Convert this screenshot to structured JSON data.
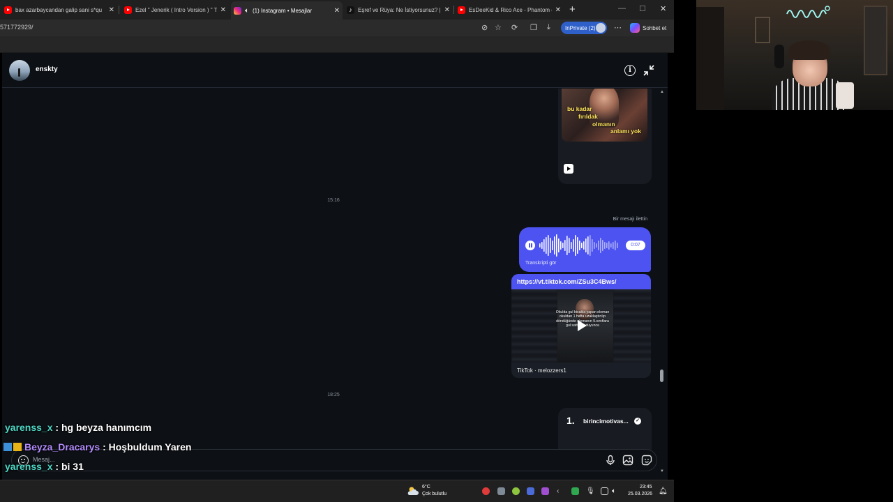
{
  "browser": {
    "tabs": [
      {
        "label": "bax azarbaycandan galip sani s*qu"
      },
      {
        "label": "Ezel \" Jenerik ( Intro Version ) \" To"
      },
      {
        "label": "(1) Instagram • Mesajlar"
      },
      {
        "label": "Eşref ve Rüya: Ne İstiyorsunuz? | Ta"
      },
      {
        "label": "EsDeeKid & Rico Ace - Phantom (L"
      }
    ],
    "url": "571772929/",
    "inprivate_label": "InPrivate (2)",
    "copilot_label": "Sohbet et"
  },
  "instagram": {
    "contact_name": "enskty",
    "timestamps": [
      "15:16",
      "18:25"
    ],
    "reel_caption": [
      "bu kadar",
      "fırıldak",
      "olmanın",
      "anlamı yok"
    ],
    "forwarded_label": "Bir mesajı ilettin",
    "voice": {
      "duration": "0:07",
      "transcript_label": "Transkripti gör"
    },
    "link": {
      "url": "https://vt.tiktok.com/ZSu3C4Bws/",
      "overlay_text": "Okulda gul bicakla yapan eleman okuldan 1 hafta uzaklaştırılıp döndüğünde elemanın 9.sınıflara gul sattığını duyunca",
      "source": "TikTok · melozzers1"
    },
    "promo": {
      "number": "1.",
      "name": "birincimotivas..."
    },
    "composer_placeholder": "Mesaj..."
  },
  "stream_chat": [
    {
      "user": "yarenss_x",
      "message": " : hg beyza hanımcım"
    },
    {
      "user": "Beyza_Dracarys",
      "message": " : Hoşbuldum Yaren"
    },
    {
      "user": "yarenss_x",
      "message": " : bi 31"
    }
  ],
  "taskbar": {
    "temperature": "6°C",
    "weather_desc": "Çok bulutlu",
    "time": "23:45",
    "date": "25.03.2026"
  },
  "colors": {
    "accent_blue": "#4d53f0",
    "ig_background": "#0d1014",
    "chat_user_1": "#4fd8c7",
    "chat_user_2": "#b38cff"
  }
}
